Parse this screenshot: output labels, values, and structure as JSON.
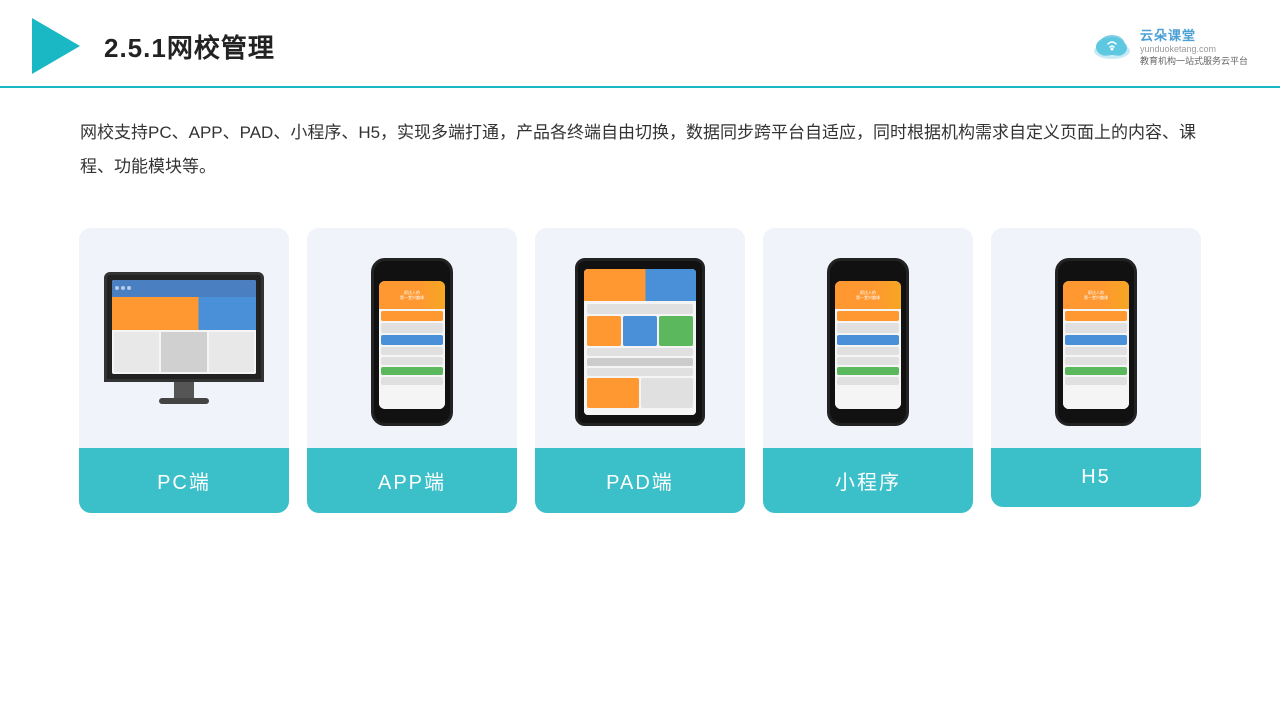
{
  "header": {
    "title": "2.5.1网校管理",
    "brand": {
      "name": "云朵课堂",
      "url": "yunduoketang.com",
      "slogan": "教育机构一站式服务云平台"
    }
  },
  "description": "网校支持PC、APP、PAD、小程序、H5，实现多端打通，产品各终端自由切换，数据同步跨平台自适应，同时根据机构需求自定义页面上的内容、课程、功能模块等。",
  "cards": [
    {
      "id": "pc",
      "label": "PC端",
      "type": "pc"
    },
    {
      "id": "app",
      "label": "APP端",
      "type": "phone"
    },
    {
      "id": "pad",
      "label": "PAD端",
      "type": "tablet"
    },
    {
      "id": "miniapp",
      "label": "小程序",
      "type": "phone"
    },
    {
      "id": "h5",
      "label": "H5",
      "type": "phone"
    }
  ]
}
